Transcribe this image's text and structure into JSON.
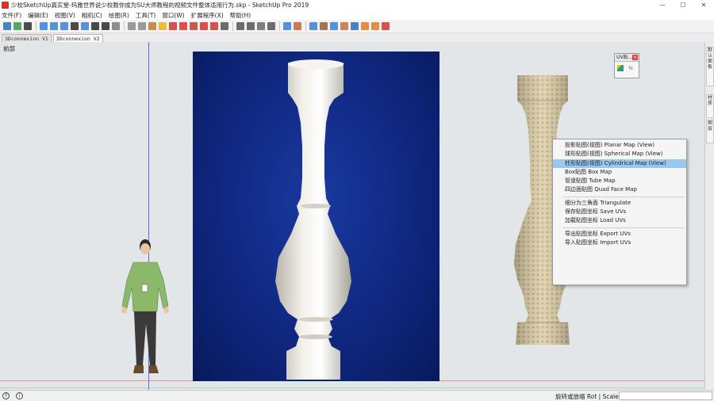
{
  "window": {
    "title": "少校SketchUp真实堂-玛雅世界说少校教你成为SU大师教程的视频文件整体适用行为.skp - SketchUp Pro 2019",
    "controls": [
      "—",
      "☐",
      "✕"
    ]
  },
  "menu": [
    "文件(F)",
    "编辑(E)",
    "视图(V)",
    "相机(C)",
    "绘图(R)",
    "工具(T)",
    "窗口(W)",
    "扩展程序(X)",
    "帮助(H)"
  ],
  "toolbar": {
    "icon_colors": [
      "#2d6fb8",
      "#3a9a4a",
      "#2d2d2d",
      "#3a7fd8",
      "#3a7fd8",
      "#3a7fd8",
      "#2a2a2a",
      "#3a7fd8",
      "#2a2a2a",
      "#2a2a2a",
      "#7a7a7a",
      "#8a8a8a",
      "#8a8a8a",
      "#c07a2a",
      "#e8b41a",
      "#d2352c",
      "#d2352c",
      "#c04030",
      "#d2352c",
      "#d2352c",
      "#555555",
      "#555555",
      "#555555",
      "#6a6a6a",
      "#555555",
      "#3a7fd8",
      "#c4643a",
      "#3a7fd8",
      "#9a5a3a",
      "#3a7fd8",
      "#c07040",
      "#2d6fb8",
      "#e07a2a",
      "#e07a2a",
      "#d2352c"
    ]
  },
  "scene_tabs": [
    {
      "label": "3Dconnexion V1",
      "active": false
    },
    {
      "label": "3Dconnexion V2",
      "active": true
    }
  ],
  "viewport": {
    "label": "前部"
  },
  "uv_panel": {
    "title": "UV贴...",
    "close": "x",
    "tool_label": "½"
  },
  "context_menu": {
    "groups": [
      [
        "投影贴图(视图) Planar Map (View)",
        "球形贴图(视图) Spherical Map (View)",
        "柱形贴图(视图) Cylindrical Map (View)",
        "Box贴图 Box Map",
        "管道贴图 Tube Map",
        "四边面贴图 Quad Face Map"
      ],
      [
        "细分为三角面 Triangulate",
        "保存贴图坐标 Save UVs",
        "加载贴图坐标 Load UVs"
      ],
      [
        "导出贴图坐标 Export UVs",
        "导入贴图坐标 Import UVs"
      ]
    ],
    "highlighted": "柱形贴图(视图) Cylindrical Map (View)"
  },
  "right_tabs": [
    "默认面板",
    "材质",
    "图层"
  ],
  "status": {
    "text": "旋转或放缩 Rot | Scale",
    "icons": [
      "?",
      "i"
    ]
  },
  "colors": {
    "photo_blue": "#0f2780",
    "highlight": "#99c8ee",
    "viewport_bg": "#e2e6e9"
  }
}
